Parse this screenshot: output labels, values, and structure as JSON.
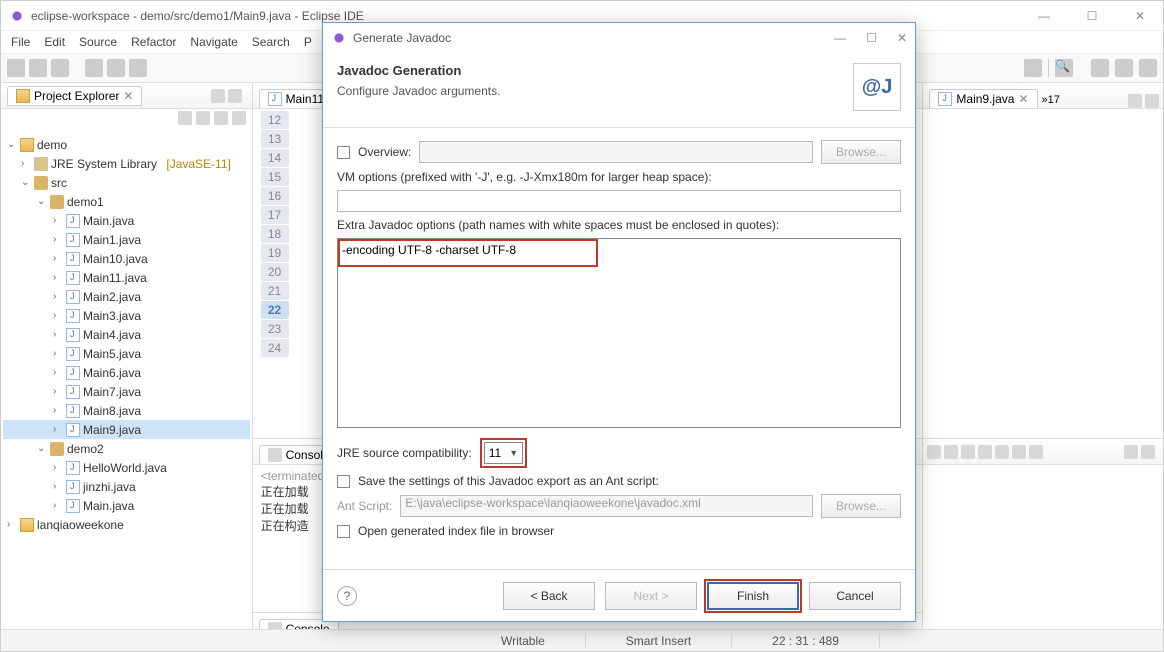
{
  "window": {
    "title": "eclipse-workspace - demo/src/demo1/Main9.java - Eclipse IDE"
  },
  "menu": [
    "File",
    "Edit",
    "Source",
    "Refactor",
    "Navigate",
    "Search",
    "P"
  ],
  "explorer": {
    "title": "Project Explorer",
    "tree": {
      "demo": "demo",
      "jre": "JRE System Library",
      "jre_suffix": "[JavaSE-11]",
      "src": "src",
      "demo1": "demo1",
      "files1": [
        "Main.java",
        "Main1.java",
        "Main10.java",
        "Main11.java",
        "Main2.java",
        "Main3.java",
        "Main4.java",
        "Main5.java",
        "Main6.java",
        "Main7.java",
        "Main8.java",
        "Main9.java"
      ],
      "demo2": "demo2",
      "files2": [
        "HelloWorld.java",
        "jinzhi.java",
        "Main.java"
      ],
      "lanqiao": "lanqiaoweekone"
    }
  },
  "editor": {
    "tab1": "Main11",
    "tab2": "Main9.java",
    "tab_more": "»17",
    "lines": [
      "12",
      "13",
      "14",
      "15",
      "16",
      "17",
      "18",
      "19",
      "20",
      "21",
      "22",
      "23",
      "24"
    ],
    "highlight": "22"
  },
  "console": {
    "tab": "Console",
    "terminated": "<terminated",
    "lines": [
      "正在加载",
      "正在加载",
      "正在构造"
    ]
  },
  "status": {
    "writable": "Writable",
    "insert": "Smart Insert",
    "pos": "22 : 31 : 489"
  },
  "dialog": {
    "title": "Generate Javadoc",
    "heading": "Javadoc Generation",
    "sub": "Configure Javadoc arguments.",
    "overview": "Overview:",
    "browse": "Browse...",
    "vm_label": "VM options (prefixed with '-J', e.g. -J-Xmx180m for larger heap space):",
    "vm_value": "",
    "extra_label": "Extra Javadoc options (path names with white spaces must be enclosed in quotes):",
    "extra_value": "-encoding UTF-8 -charset  UTF-8",
    "jre_label": "JRE source compatibility:",
    "jre_value": "11",
    "save_label": "Save the settings of this Javadoc export as an Ant script:",
    "ant_label": "Ant Script:",
    "ant_value": "E:\\java\\eclipse-workspace\\lanqiaoweekone\\javadoc.xml",
    "open_label": "Open generated index file in browser",
    "back": "< Back",
    "next": "Next >",
    "finish": "Finish",
    "cancel": "Cancel"
  }
}
